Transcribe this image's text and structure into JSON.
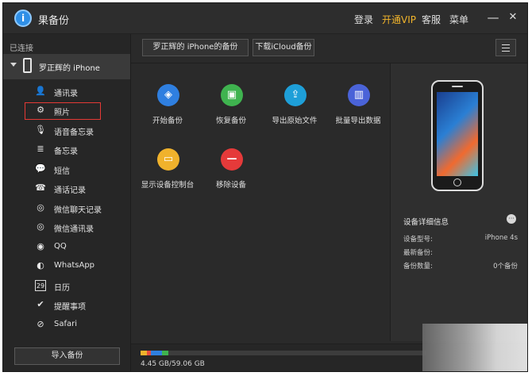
{
  "titlebar": {
    "app_title": "果备份",
    "logo_glyph": "i",
    "links": [
      "登录",
      "开通VIP",
      "客服",
      "菜单"
    ],
    "minimize": "—",
    "close": "✕"
  },
  "sidebar": {
    "section_label": "已连接",
    "device_name": "罗正辉的 iPhone",
    "items": [
      {
        "label": "通讯录",
        "icon": "contacts-icon",
        "glyph": "👤"
      },
      {
        "label": "照片",
        "icon": "gear-icon",
        "glyph": "⚙"
      },
      {
        "label": "语音备忘录",
        "icon": "microphone-icon",
        "glyph": "🎙"
      },
      {
        "label": "备忘录",
        "icon": "notes-icon",
        "glyph": "≣"
      },
      {
        "label": "短信",
        "icon": "message-icon",
        "glyph": "💬"
      },
      {
        "label": "通话记录",
        "icon": "phone-call-icon",
        "glyph": "☎"
      },
      {
        "label": "微信聊天记录",
        "icon": "wechat-icon",
        "glyph": "◎"
      },
      {
        "label": "微信通讯录",
        "icon": "wechat-contacts-icon",
        "glyph": "◎"
      },
      {
        "label": "QQ",
        "icon": "qq-icon",
        "glyph": "◉"
      },
      {
        "label": "WhatsApp",
        "icon": "whatsapp-icon",
        "glyph": "◐"
      },
      {
        "label": "日历",
        "icon": "calendar-icon",
        "glyph": "29"
      },
      {
        "label": "提醒事项",
        "icon": "reminder-icon",
        "glyph": "✔"
      },
      {
        "label": "Safari",
        "icon": "safari-icon",
        "glyph": "⊘"
      }
    ],
    "active_index": 1,
    "import_button": "导入备份"
  },
  "toolbar": {
    "iphone_backup": "罗正辉的 iPhone的备份",
    "icloud_download": "下载iCloud备份"
  },
  "actions": [
    {
      "label": "开始备份",
      "icon": "layers-icon",
      "glyph": "◈",
      "color": "#2f7fe0"
    },
    {
      "label": "恢复备份",
      "icon": "phone-restore-icon",
      "glyph": "▣",
      "color": "#3fb34f"
    },
    {
      "label": "导出原始文件",
      "icon": "export-icon",
      "glyph": "⇪",
      "color": "#1e9fd8"
    },
    {
      "label": "批量导出数据",
      "icon": "batch-export-icon",
      "glyph": "▥",
      "color": "#4a63d8"
    },
    {
      "label": "显示设备控制台",
      "icon": "console-icon",
      "glyph": "▭",
      "color": "#f0b22c"
    },
    {
      "label": "移除设备",
      "icon": "remove-icon",
      "glyph": "—",
      "color": "#e53a3a"
    }
  ],
  "device_info": {
    "title": "设备详细信息",
    "rows": [
      {
        "key": "设备型号:",
        "value": "iPhone 4s"
      },
      {
        "key": "最新备份:",
        "value": ""
      },
      {
        "key": "备份数量:",
        "value": "0个备份"
      }
    ]
  },
  "storage": {
    "text": "4.45 GB/59.06 GB",
    "segment_colors": [
      "#f0b22c",
      "#e84c3d",
      "#2f7fe0",
      "#3fb34f"
    ]
  }
}
